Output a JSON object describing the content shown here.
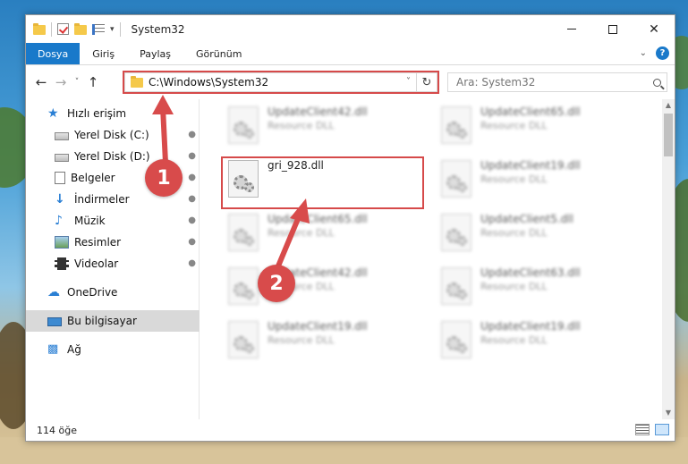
{
  "window": {
    "title": "System32",
    "minimize_label": "",
    "maximize_label": "",
    "close_label": "✕"
  },
  "ribbon": {
    "tabs": [
      "Dosya",
      "Giriş",
      "Paylaş",
      "Görünüm"
    ],
    "help_label": "?"
  },
  "navigation": {
    "back_label": "←",
    "forward_label": "→",
    "recent_label": "˅",
    "up_label": "↑",
    "address": "C:\\Windows\\System32",
    "address_dropdown": "˅",
    "refresh_label": "↻",
    "search_placeholder": "Ara: System32"
  },
  "sidebar": {
    "items": [
      {
        "label": "Hızlı erişim",
        "icon": "star-icon"
      },
      {
        "label": "Yerel Disk (C:)",
        "icon": "drive-icon",
        "pinned": true
      },
      {
        "label": "Yerel Disk (D:)",
        "icon": "drive-icon",
        "pinned": true
      },
      {
        "label": "Belgeler",
        "icon": "documents-icon",
        "pinned": true
      },
      {
        "label": "İndirmeler",
        "icon": "download-icon",
        "pinned": true
      },
      {
        "label": "Müzik",
        "icon": "music-icon",
        "pinned": true
      },
      {
        "label": "Resimler",
        "icon": "pictures-icon",
        "pinned": true
      },
      {
        "label": "Videolar",
        "icon": "videos-icon",
        "pinned": true
      },
      {
        "label": "OneDrive",
        "icon": "cloud-icon"
      },
      {
        "label": "Bu bilgisayar",
        "icon": "computer-icon",
        "selected": true
      },
      {
        "label": "Ağ",
        "icon": "network-icon"
      }
    ],
    "pin_glyph": "📌"
  },
  "files": {
    "highlighted": {
      "name": "gri_928.dll",
      "type": ""
    },
    "others": [
      {
        "name": "UpdateClient42.dll",
        "type": "Resource DLL"
      },
      {
        "name": "UpdateClient65.dll",
        "type": "Resource DLL"
      },
      {
        "name": "UpdateClient19.dll",
        "type": "Resource DLL"
      },
      {
        "name": "UpdateClient65.dll",
        "type": "Resource DLL"
      },
      {
        "name": "UpdateClient5.dll",
        "type": "Resource DLL"
      },
      {
        "name": "UpdateClient42.dll",
        "type": "Resource DLL"
      },
      {
        "name": "UpdateClient63.dll",
        "type": "Resource DLL"
      },
      {
        "name": "UpdateClient19.dll",
        "type": "Resource DLL"
      },
      {
        "name": "UpdateClient19.dll",
        "type": "Resource DLL"
      }
    ]
  },
  "status": {
    "item_count": "114 öğe"
  },
  "annotations": {
    "step1": "1",
    "step2": "2",
    "color": "#d84b4b"
  },
  "colors": {
    "accent": "#1979ca",
    "highlight": "#d64a4a"
  }
}
